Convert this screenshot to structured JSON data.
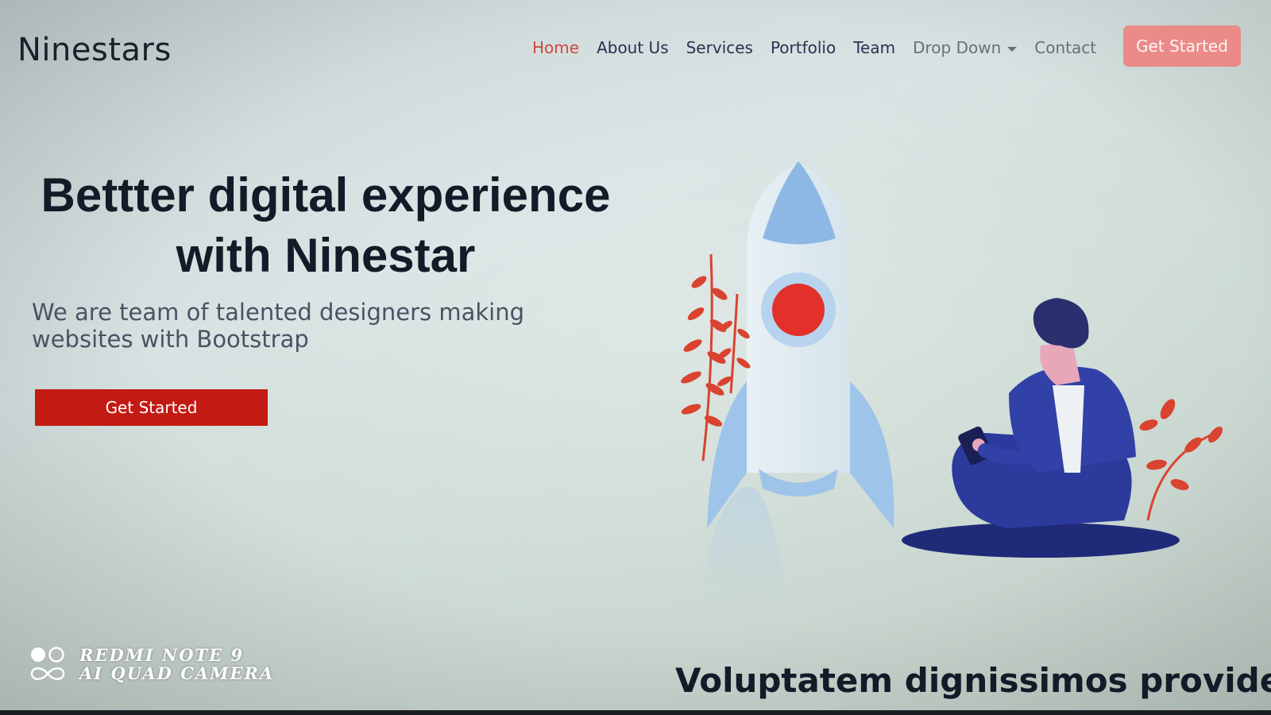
{
  "header": {
    "brand": "Ninestars",
    "nav": [
      {
        "label": "Home",
        "state": "active"
      },
      {
        "label": "About Us"
      },
      {
        "label": "Services"
      },
      {
        "label": "Portfolio"
      },
      {
        "label": "Team"
      },
      {
        "label": "Drop Down",
        "has_dropdown": true
      },
      {
        "label": "Contact"
      }
    ],
    "cta_label": "Get Started"
  },
  "hero": {
    "title_line1": "Bettter digital experience",
    "title_line2": "with Ninestar",
    "subtitle_line1": "We are team of talented designers making",
    "subtitle_line2": "websites with Bootstrap",
    "cta_label": "Get Started",
    "illustration_icons": [
      "rocket-icon",
      "plant-icon",
      "person-with-phone-icon"
    ]
  },
  "next_section": {
    "title": "Voluptatem dignissimos provident"
  },
  "watermark": {
    "line1": "REDMI NOTE 9",
    "line2": "AI QUAD CAMERA"
  },
  "colors": {
    "accent": "#c41a14",
    "nav_active": "#d1473c",
    "nav_cta": "#ea8b88",
    "text_dark": "#141a28",
    "illustration_blue": "#2c3a9c",
    "rocket_light": "#a9c9ea"
  }
}
